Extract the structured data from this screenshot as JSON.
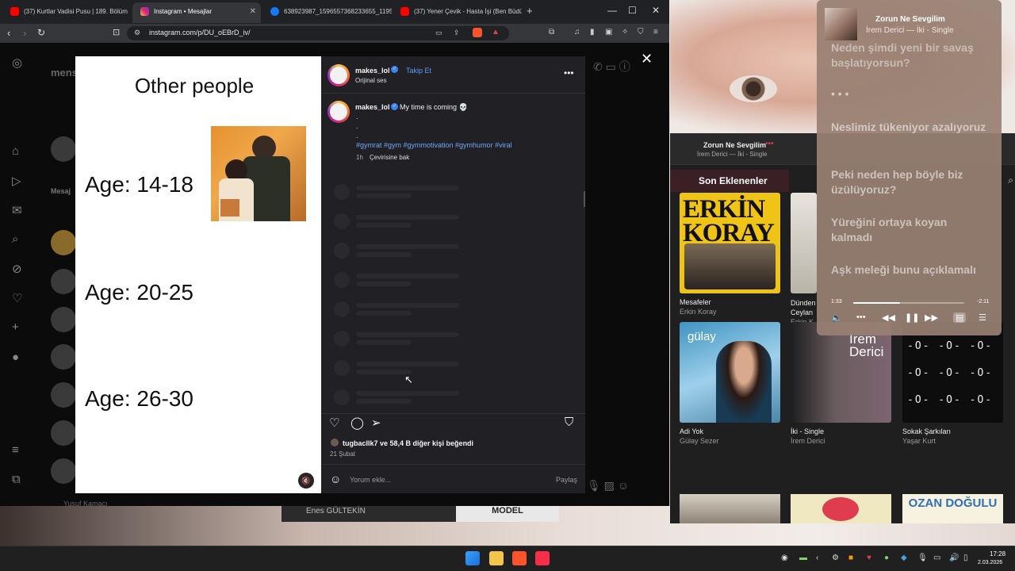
{
  "browser": {
    "tabs": [
      {
        "label": "(37) Kurtlar Vadisi Pusu | 189. Bölüm",
        "icon": "youtube-icon",
        "color": "#ff0000"
      },
      {
        "label": "Instagram • Mesajlar",
        "icon": "instagram-icon",
        "color": "#d62976"
      },
      {
        "label": "638923987_1596557368233655_1195",
        "icon": "facebook-icon",
        "color": "#1877f2"
      },
      {
        "label": "(37) Yener Çevik - Hasta İşi (Ben Büdü",
        "icon": "youtube-icon",
        "color": "#ff0000"
      }
    ],
    "url": "instagram.com/p/DU_oEBrD_iv/"
  },
  "instagram": {
    "page_title_dim": "mens",
    "messages_label_dim": "Mesaj",
    "dim_contact": "Yusuf Kamacı",
    "post": {
      "username": "makes_lol",
      "follow_label": "Takip Et",
      "audio_label": "Orijinal ses",
      "caption": "My time is coming 💀",
      "caption_dots": [
        ".",
        ".",
        "."
      ],
      "hashtags": "#gymrat #gym #gymmotivation #gymhumor #viral",
      "time_ago": "1h",
      "translate_label": "Çevirisine bak",
      "likes_text": "tugbacllk7 ve 58,4 B diğer kişi beğendi",
      "date": "21 Şubat",
      "comment_placeholder": "Yorum ekle...",
      "share_label": "Paylaş"
    },
    "media": {
      "title": "Other people",
      "ages": [
        "Age: 14-18",
        "Age: 20-25",
        "Age: 26-30"
      ]
    }
  },
  "music_app": {
    "now_playing_title": "Zorun Ne Sevgilim",
    "now_playing_sub": "İrem Derici — İki - Single",
    "section_label": "Son Eklenenler",
    "albums": [
      {
        "title": "Mesafeler",
        "artist": "Erkin Koray",
        "cover_text": "ERKİN KORAY"
      },
      {
        "title": "Dünden Ceylan",
        "artist": "Erkin K",
        "cover_text": ""
      },
      {
        "title": "Adi Yok",
        "artist": "Gülay Sezer",
        "cover_text": "gülay"
      },
      {
        "title": "İki - Single",
        "artist": "İrem Derici",
        "cover_text": "İrem Derici"
      },
      {
        "title": "Sokak Şarkıları",
        "artist": "Yaşar Kurt",
        "cover_text": ""
      }
    ],
    "bottom_album_text": "OZAN DOĞULU"
  },
  "behind": {
    "name": "Enes GÜLTEKİN",
    "model": "MODEL"
  },
  "mini_player": {
    "title": "Zorun Ne Sevgilim",
    "artist": "İrem Derici — İki - Single",
    "lyrics_top": "Neden şimdi yeni bir savaş başlatıyorsun?",
    "lyrics": [
      "Neslimiz tükeniyor azalıyoruz",
      "Peki neden hep böyle biz üzülüyoruz?",
      "Yüreğini ortaya koyan kalmadı",
      "Aşk meleği bunu açıklamalı"
    ],
    "elapsed": "1:33",
    "remaining": "-2:11",
    "progress": 0.42
  },
  "taskbar": {
    "time": "17:28",
    "date": "2.03.2026"
  },
  "colors": {
    "instagram_blue": "#5f9cf5",
    "hashtag_blue": "#6fa6f8",
    "music_accent": "#e03c4f"
  }
}
